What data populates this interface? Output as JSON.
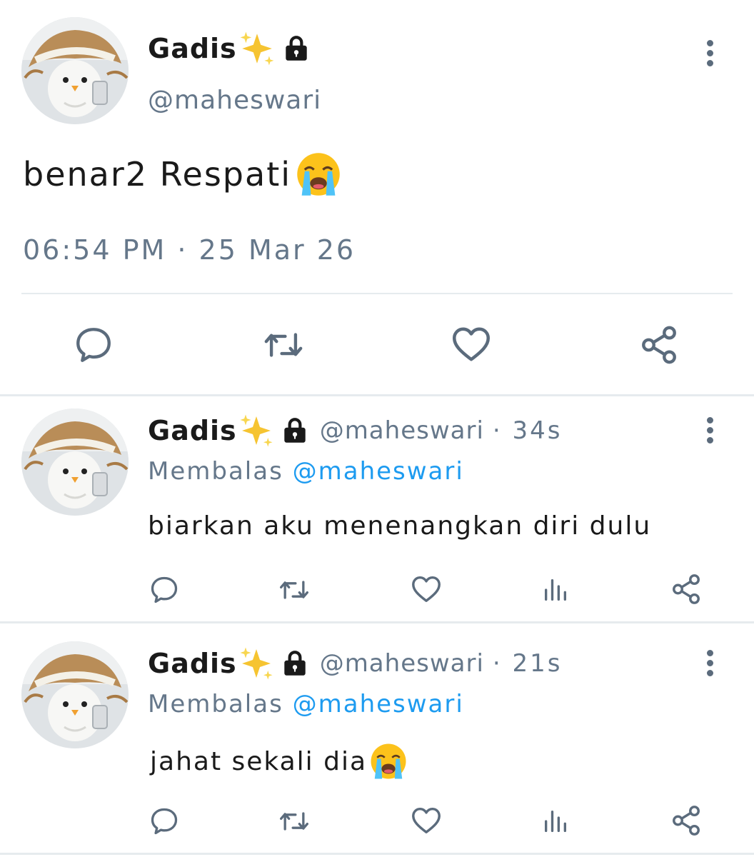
{
  "colors": {
    "muted": "#65778a",
    "link": "#1d9bf0",
    "icon": "#5b6b7c",
    "divider": "#e6ebee"
  },
  "main_post": {
    "display_name": "Gadis",
    "name_emoji": "sparkles",
    "lock_icon": "lock-icon",
    "handle": "@maheswari",
    "text": "benar2 Respati",
    "text_emoji": "loudly-crying-face",
    "timestamp": "06:54 PM · 25 Mar 26",
    "actions": [
      "reply-icon",
      "retweet-icon",
      "like-icon",
      "share-icon"
    ]
  },
  "replies": [
    {
      "display_name": "Gadis",
      "handle": "@maheswari",
      "meta": "· 34s",
      "replying_label": "Membalas",
      "replying_to": "@maheswari",
      "text": "biarkan aku menenangkan diri dulu",
      "actions": [
        "reply-icon",
        "retweet-icon",
        "like-icon",
        "views-icon",
        "share-icon"
      ]
    },
    {
      "display_name": "Gadis",
      "handle": "@maheswari",
      "meta": "· 21s",
      "replying_label": "Membalas",
      "replying_to": "@maheswari",
      "text": "jahat sekali dia",
      "text_emoji": "loudly-crying-face",
      "actions": [
        "reply-icon",
        "retweet-icon",
        "like-icon",
        "views-icon",
        "share-icon"
      ]
    }
  ]
}
